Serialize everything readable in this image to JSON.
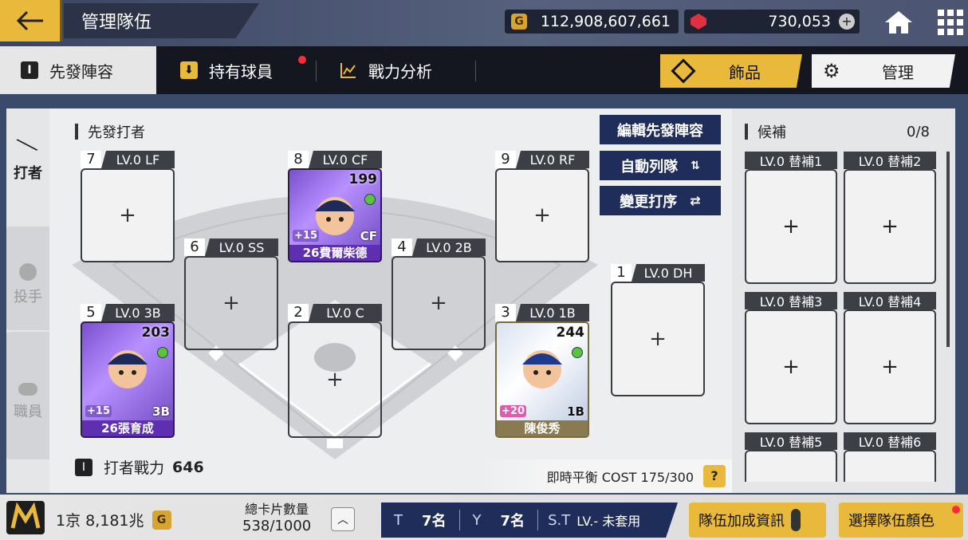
{
  "header": {
    "title": "管理隊伍",
    "gold": "112,908,607,661",
    "gems": "730,053",
    "gold_icon": "G"
  },
  "tabs": {
    "starting": "先發陣容",
    "owned": "持有球員",
    "analysis": "戰力分析",
    "accessory": "飾品",
    "manage": "管理"
  },
  "side_tabs": {
    "hitter": "打者",
    "pitcher": "投手",
    "staff": "職員"
  },
  "section": {
    "starting_hitters": "先發打者",
    "bench": "候補",
    "bench_count": "0/8"
  },
  "buttons": {
    "edit_lineup": "編輯先發陣容",
    "auto_lineup": "自動列隊",
    "change_order": "變更打序",
    "help": "?"
  },
  "slots": [
    {
      "num": "7",
      "lv": "LV.0 LF"
    },
    {
      "num": "8",
      "lv": "LV.0 CF",
      "player": {
        "name": "26費爾柴德",
        "ovr": "199",
        "pos": "CF",
        "plus": "+15"
      }
    },
    {
      "num": "9",
      "lv": "LV.0 RF"
    },
    {
      "num": "6",
      "lv": "LV.0 SS"
    },
    {
      "num": "4",
      "lv": "LV.0 2B"
    },
    {
      "num": "1",
      "lv": "LV.0 DH"
    },
    {
      "num": "5",
      "lv": "LV.0 3B",
      "player": {
        "name": "26張育成",
        "ovr": "203",
        "pos": "3B",
        "plus": "+15"
      }
    },
    {
      "num": "2",
      "lv": "LV.0 C"
    },
    {
      "num": "3",
      "lv": "LV.0 1B",
      "player": {
        "name": "陳俊秀",
        "ovr": "244",
        "pos": "1B",
        "plus": "+20"
      }
    }
  ],
  "plus_sign": "+",
  "bench_slots": [
    "LV.0 替補1",
    "LV.0 替補2",
    "LV.0 替補3",
    "LV.0 替補4",
    "LV.0 替補5",
    "LV.0 替補6"
  ],
  "power": {
    "label": "打者戰力",
    "value": "646"
  },
  "cost": "即時平衡 COST 175/300",
  "footer": {
    "money": "1京 8,181兆",
    "money_icon": "G",
    "card_count_label": "總卡片數量",
    "card_count": "538/1000",
    "t_label": "T",
    "t_value": "7名",
    "y_label": "Y",
    "y_value": "7名",
    "st_label": "S.T",
    "st_value": "LV.- 未套用",
    "team_bonus": "隊伍加成資訊",
    "team_color": "選擇隊伍顏色"
  },
  "colors": {
    "accent": "#e8b93a",
    "navy": "#1e2d5a",
    "dark": "#14171f"
  }
}
